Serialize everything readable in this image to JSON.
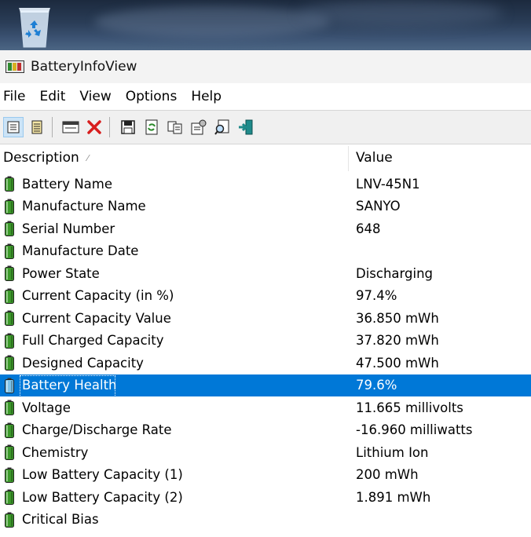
{
  "desktop": {
    "recycle_bin_icon": "recycle-bin-icon"
  },
  "window": {
    "title": "BatteryInfoView"
  },
  "menu": [
    "File",
    "Edit",
    "View",
    "Options",
    "Help"
  ],
  "toolbar": {
    "icons": [
      "properties-icon",
      "report-icon",
      "window-icon",
      "delete-icon",
      "save-icon",
      "refresh-icon",
      "copy-icon",
      "options-icon",
      "find-icon",
      "exit-icon"
    ]
  },
  "columns": {
    "description": "Description",
    "value": "Value"
  },
  "rows": [
    {
      "label": "Battery Name",
      "value": "LNV-45N1"
    },
    {
      "label": "Manufacture Name",
      "value": "SANYO"
    },
    {
      "label": "Serial Number",
      "value": " 648"
    },
    {
      "label": "Manufacture Date",
      "value": ""
    },
    {
      "label": "Power State",
      "value": "Discharging"
    },
    {
      "label": "Current Capacity (in %)",
      "value": "97.4%"
    },
    {
      "label": "Current Capacity Value",
      "value": "36.850 mWh"
    },
    {
      "label": "Full Charged Capacity",
      "value": "37.820 mWh"
    },
    {
      "label": "Designed Capacity",
      "value": "47.500 mWh"
    },
    {
      "label": "Battery Health",
      "value": "79.6%",
      "selected": true
    },
    {
      "label": "Voltage",
      "value": "11.665 millivolts"
    },
    {
      "label": "Charge/Discharge Rate",
      "value": "-16.960 milliwatts"
    },
    {
      "label": "Chemistry",
      "value": "Lithium Ion"
    },
    {
      "label": "Low Battery Capacity (1)",
      "value": "200 mWh"
    },
    {
      "label": "Low Battery Capacity (2)",
      "value": "1.891 mWh"
    },
    {
      "label": "Critical Bias",
      "value": ""
    }
  ],
  "colors": {
    "selection": "#0078d7",
    "battery_green": "#3c9a2a"
  }
}
